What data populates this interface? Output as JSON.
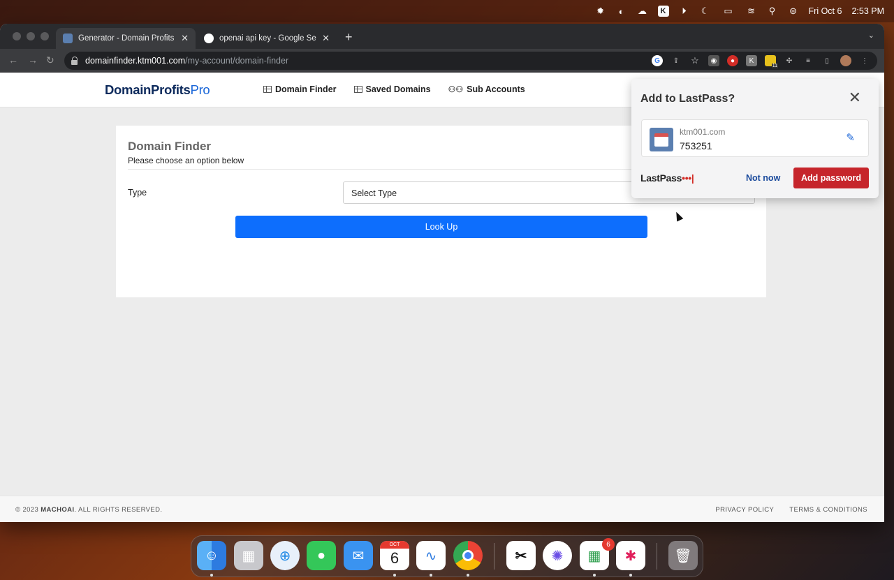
{
  "menubar": {
    "date": "Fri Oct 6",
    "time": "2:53 PM",
    "icons": [
      "settings-icon",
      "app-icon",
      "creative-cloud-icon",
      "k-icon",
      "play-icon",
      "moon-icon",
      "battery-icon",
      "wifi-icon",
      "search-icon",
      "control-center-icon"
    ]
  },
  "browser": {
    "tabs": [
      {
        "title": "Generator - Domain Profits Pr",
        "active": true
      },
      {
        "title": "openai api key - Google Searc",
        "active": false
      }
    ],
    "url_host": "domainfinder.ktm001.com",
    "url_path": "/my-account/domain-finder",
    "extension_badge": "11"
  },
  "site": {
    "logo_part1": "DomainProfits",
    "logo_part2": "Pro",
    "nav": [
      {
        "label": "Domain Finder"
      },
      {
        "label": "Saved Domains"
      },
      {
        "label": "Sub Accounts"
      }
    ]
  },
  "card": {
    "title": "Domain Finder",
    "subtitle": "Please choose an option below",
    "type_label": "Type",
    "select_value": "Select Type",
    "lookup_label": "Look Up"
  },
  "footer": {
    "copyright_prefix": "© 2023",
    "copyright_brand": "MACHOAI",
    "copyright_suffix": ". ALL RIGHTS RESERVED.",
    "privacy": "PRIVACY POLICY",
    "terms": "TERMS & CONDITIONS"
  },
  "lastpass": {
    "title": "Add to LastPass?",
    "domain": "ktm001.com",
    "username": "753251",
    "logo_text": "LastPass",
    "logo_dots": "•••|",
    "not_now": "Not now",
    "add_password": "Add password"
  },
  "dock": {
    "calendar_month": "OCT",
    "calendar_day": "6",
    "store_badge": "6"
  },
  "colors": {
    "primary_button": "#0d6efd",
    "lastpass_red": "#c6252b",
    "logo_navy": "#0d2a5c",
    "logo_blue": "#1a66d8"
  }
}
